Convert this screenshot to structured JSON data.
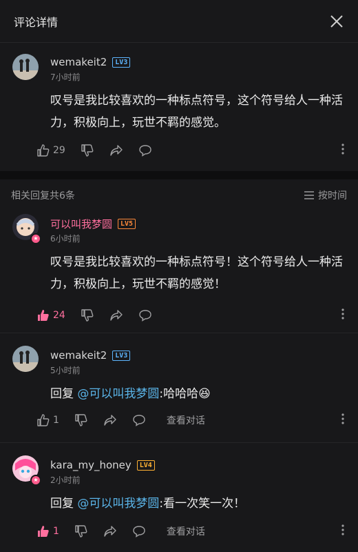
{
  "header": {
    "title": "评论详情"
  },
  "main_comment": {
    "username": "wemakeit2",
    "level": "LV3",
    "time": "7小时前",
    "text": "叹号是我比较喜欢的一种标点符号，这个符号给人一种活力，积极向上，玩世不羁的感觉。",
    "likes": "29"
  },
  "replies_section": {
    "title": "相关回复共6条",
    "sort_label": "按时间"
  },
  "replies": [
    {
      "username": "可以叫我梦圆",
      "level": "LV5",
      "time": "6小时前",
      "text": "叹号是我比较喜欢的一种标点符号！这个符号给人一种活力，积极向上，玩世不羁的感觉！",
      "likes": "24"
    },
    {
      "username": "wemakeit2",
      "level": "LV3",
      "time": "5小时前",
      "reply_prefix": "回复 ",
      "mention": "@可以叫我梦圆",
      "text": ":哈哈哈",
      "emoji": "😆",
      "likes": "1",
      "view_convo": "查看对话"
    },
    {
      "username": "kara_my_honey",
      "level": "LV4",
      "time": "2小时前",
      "reply_prefix": "回复 ",
      "mention": "@可以叫我梦圆",
      "text": ":看一次笑一次！",
      "likes": "1",
      "view_convo": "查看对话"
    }
  ],
  "colors": {
    "accent_pink": "#ff6f9e",
    "mention_blue": "#5ab4e8",
    "background": "#18181a"
  }
}
